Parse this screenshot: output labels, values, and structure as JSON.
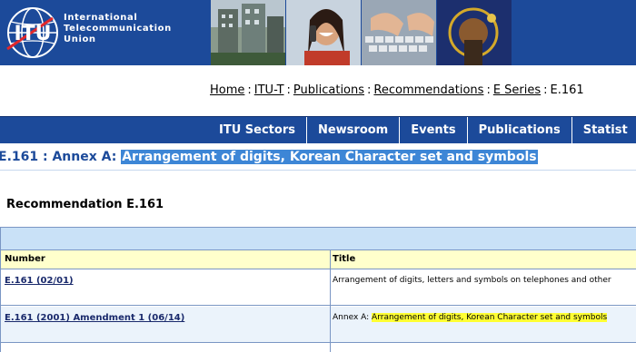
{
  "header": {
    "org_name_lines": [
      "International",
      "Telecommunication",
      "Union"
    ],
    "logo_text": "ITU"
  },
  "breadcrumb": {
    "items": [
      "Home",
      "ITU-T",
      "Publications",
      "Recommendations",
      "E Series"
    ],
    "separator": ":",
    "current": "E.161"
  },
  "nav": {
    "items": [
      "ITU Sectors",
      "Newsroom",
      "Events",
      "Publications",
      "Statist"
    ]
  },
  "page": {
    "heading_prefix": "E.161 : Annex A:",
    "heading_highlight": "Arrangement of digits, Korean Character set and symbols",
    "rec_title": "Recommendation E.161"
  },
  "table": {
    "headers": [
      "Number",
      "Title"
    ],
    "rows": [
      {
        "number": "E.161 (02/01)",
        "title_prefix": "",
        "title": "Arrangement of digits, letters and symbols on telephones and other",
        "highlight": false
      },
      {
        "number": "E.161 (2001) Amendment 1 (06/14)",
        "title_prefix": "Annex A:",
        "title": "Arrangement of digits, Korean Character set and symbols",
        "highlight": true
      }
    ]
  },
  "colors": {
    "brand_blue": "#1c4a9a",
    "selection_blue": "#3d86d6",
    "table_band": "#c9e1f7",
    "header_yellow": "#ffffcc",
    "highlight_yellow": "#ffff33"
  }
}
